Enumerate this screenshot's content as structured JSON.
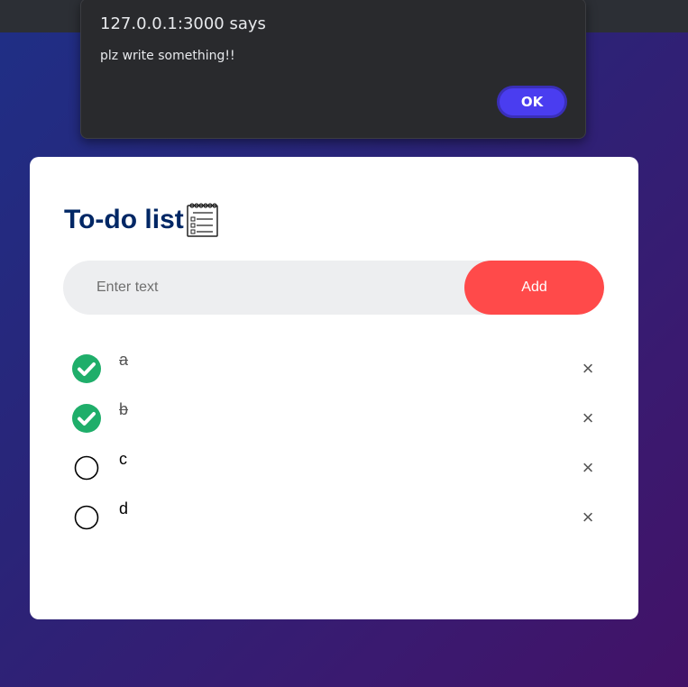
{
  "alert": {
    "title": "127.0.0.1:3000 says",
    "message": "plz write something!!",
    "ok_label": "OK"
  },
  "app": {
    "title": "To-do list",
    "input_placeholder": "Enter text",
    "input_value": "",
    "add_label": "Add"
  },
  "todos": [
    {
      "text": "a",
      "checked": true,
      "delete_label": "×"
    },
    {
      "text": "b",
      "checked": true,
      "delete_label": "×"
    },
    {
      "text": "c",
      "checked": false,
      "delete_label": "×"
    },
    {
      "text": "d",
      "checked": false,
      "delete_label": "×"
    }
  ],
  "colors": {
    "title": "#002765",
    "add_button": "#ff4a4a",
    "checked": "#1fae6a",
    "ok_button": "#4a3df0"
  }
}
